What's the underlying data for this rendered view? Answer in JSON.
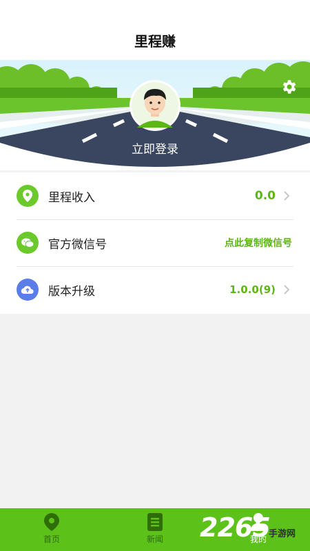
{
  "app": {
    "title": "里程赚"
  },
  "banner": {
    "login_label": "立即登录"
  },
  "menu": {
    "items": [
      {
        "label": "里程收入",
        "value": "0.0",
        "icon": "location-pin-icon",
        "icon_color": "#6cc92c"
      },
      {
        "label": "官方微信号",
        "value": "点此复制微信号",
        "icon": "wechat-icon",
        "icon_color": "#6cc92c"
      },
      {
        "label": "版本升级",
        "value": "1.0.0(9)",
        "icon": "cloud-upload-icon",
        "icon_color": "#5b7de8"
      }
    ]
  },
  "tabbar": {
    "tabs": [
      {
        "label": "首页",
        "icon": "location-pin-icon"
      },
      {
        "label": "新闻",
        "icon": "news-icon"
      },
      {
        "label": "我的",
        "icon": "user-icon"
      }
    ]
  },
  "watermark": {
    "number": "2265",
    "site": "手游网"
  },
  "colors": {
    "accent": "#5cb615",
    "tabbar": "#5cc21a",
    "road": "#3a4660"
  }
}
